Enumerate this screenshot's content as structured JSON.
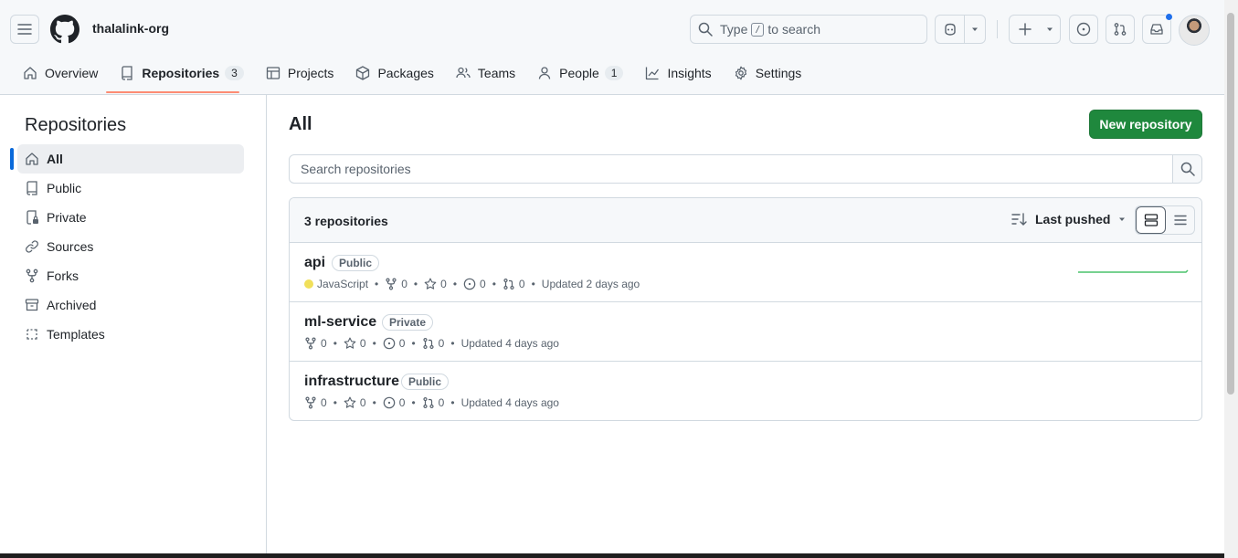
{
  "header": {
    "org_name": "thalalink-org",
    "search_prefix": "Type",
    "search_key": "/",
    "search_suffix": "to search"
  },
  "tabs": [
    {
      "label": "Overview",
      "icon": "home-icon"
    },
    {
      "label": "Repositories",
      "icon": "repo-icon",
      "count": "3",
      "selected": true
    },
    {
      "label": "Projects",
      "icon": "table-icon"
    },
    {
      "label": "Packages",
      "icon": "package-icon"
    },
    {
      "label": "Teams",
      "icon": "people-icon"
    },
    {
      "label": "People",
      "icon": "person-icon",
      "count": "1"
    },
    {
      "label": "Insights",
      "icon": "graph-icon"
    },
    {
      "label": "Settings",
      "icon": "gear-icon"
    }
  ],
  "sidebar": {
    "title": "Repositories",
    "items": [
      {
        "label": "All",
        "icon": "home-icon",
        "active": true
      },
      {
        "label": "Public",
        "icon": "repo-icon"
      },
      {
        "label": "Private",
        "icon": "lock-repo-icon"
      },
      {
        "label": "Sources",
        "icon": "link-icon"
      },
      {
        "label": "Forks",
        "icon": "fork-icon"
      },
      {
        "label": "Archived",
        "icon": "archive-icon"
      },
      {
        "label": "Templates",
        "icon": "template-icon"
      }
    ]
  },
  "main": {
    "title": "All",
    "new_repo_label": "New repository",
    "search_placeholder": "Search repositories",
    "count_label": "3 repositories",
    "sort_label": "Last pushed"
  },
  "repos": [
    {
      "name": "api",
      "visibility": "Public",
      "language": "JavaScript",
      "language_color": "#f1e05a",
      "forks": "0",
      "stars": "0",
      "issues": "0",
      "prs": "0",
      "updated": "Updated 2 days ago"
    },
    {
      "name": "ml-service",
      "visibility": "Private",
      "forks": "0",
      "stars": "0",
      "issues": "0",
      "prs": "0",
      "updated": "Updated 4 days ago"
    },
    {
      "name": "infrastructure",
      "visibility": "Public",
      "forks": "0",
      "stars": "0",
      "issues": "0",
      "prs": "0",
      "updated": "Updated 4 days ago"
    }
  ]
}
